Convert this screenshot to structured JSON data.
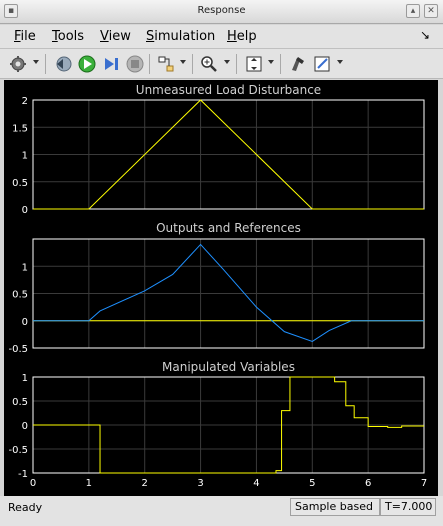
{
  "window": {
    "title": "Response"
  },
  "menu": [
    {
      "label": "File",
      "mnemonic": "F"
    },
    {
      "label": "Tools",
      "mnemonic": "T"
    },
    {
      "label": "View",
      "mnemonic": "V"
    },
    {
      "label": "Simulation",
      "mnemonic": "S"
    },
    {
      "label": "Help",
      "mnemonic": "H"
    }
  ],
  "toolbar": {
    "icons": [
      "gear-icon",
      "step-back-icon",
      "run-icon",
      "step-forward-icon",
      "stop-icon",
      "signal-select-icon",
      "zoom-icon",
      "fit-to-view-icon",
      "highlight-icon",
      "edit-icon"
    ]
  },
  "status": {
    "left": "Ready",
    "mode": "Sample based",
    "time": "T=7.000"
  },
  "colors": {
    "background": "#000000",
    "axes": "#ffffff",
    "grid": "#3a3a3a",
    "yellow": "#ffff00",
    "blue": "#1e90ff"
  },
  "chart_data": [
    {
      "type": "line",
      "title": "Unmeasured Load Disturbance",
      "xlim": [
        0,
        7
      ],
      "ylim": [
        0,
        2
      ],
      "yticks": [
        "0",
        "0.5",
        "1",
        "1.5",
        "2"
      ],
      "xticks": [],
      "series": [
        {
          "color": "#ffff00",
          "x": [
            0,
            1,
            3,
            5,
            7
          ],
          "y": [
            0,
            0,
            2,
            0,
            0
          ]
        }
      ]
    },
    {
      "type": "line",
      "title": "Outputs and References",
      "xlim": [
        0,
        7
      ],
      "ylim": [
        -0.5,
        1.5
      ],
      "yticks": [
        "-0.5",
        "0",
        "0.5",
        "1"
      ],
      "xticks": [],
      "series": [
        {
          "color": "#ffff00",
          "x": [
            0,
            7
          ],
          "y": [
            0,
            0
          ]
        },
        {
          "color": "#1e90ff",
          "x": [
            0,
            1,
            1.2,
            2,
            2.5,
            3,
            3.4,
            4,
            4.5,
            5,
            5.3,
            5.7,
            7
          ],
          "y": [
            0,
            0,
            0.18,
            0.55,
            0.85,
            1.4,
            0.95,
            0.25,
            -0.2,
            -0.38,
            -0.18,
            0,
            0
          ]
        }
      ]
    },
    {
      "type": "line",
      "title": "Manipulated Variables",
      "xlim": [
        0,
        7
      ],
      "ylim": [
        -1,
        1
      ],
      "yticks": [
        "-1",
        "-0.5",
        "0",
        "0.5",
        "1"
      ],
      "xticks": [
        "0",
        "1",
        "2",
        "3",
        "4",
        "5",
        "6",
        "7"
      ],
      "series": [
        {
          "color": "#ffff00",
          "step": true,
          "x": [
            0,
            1.2,
            4.35,
            4.45,
            4.6,
            5.2,
            5.4,
            5.6,
            5.75,
            6.0,
            6.35,
            6.6,
            7
          ],
          "y": [
            0,
            -1,
            -0.95,
            0.3,
            1,
            1,
            0.9,
            0.4,
            0.15,
            -0.03,
            -0.05,
            -0.02,
            -0.02
          ]
        }
      ]
    }
  ]
}
